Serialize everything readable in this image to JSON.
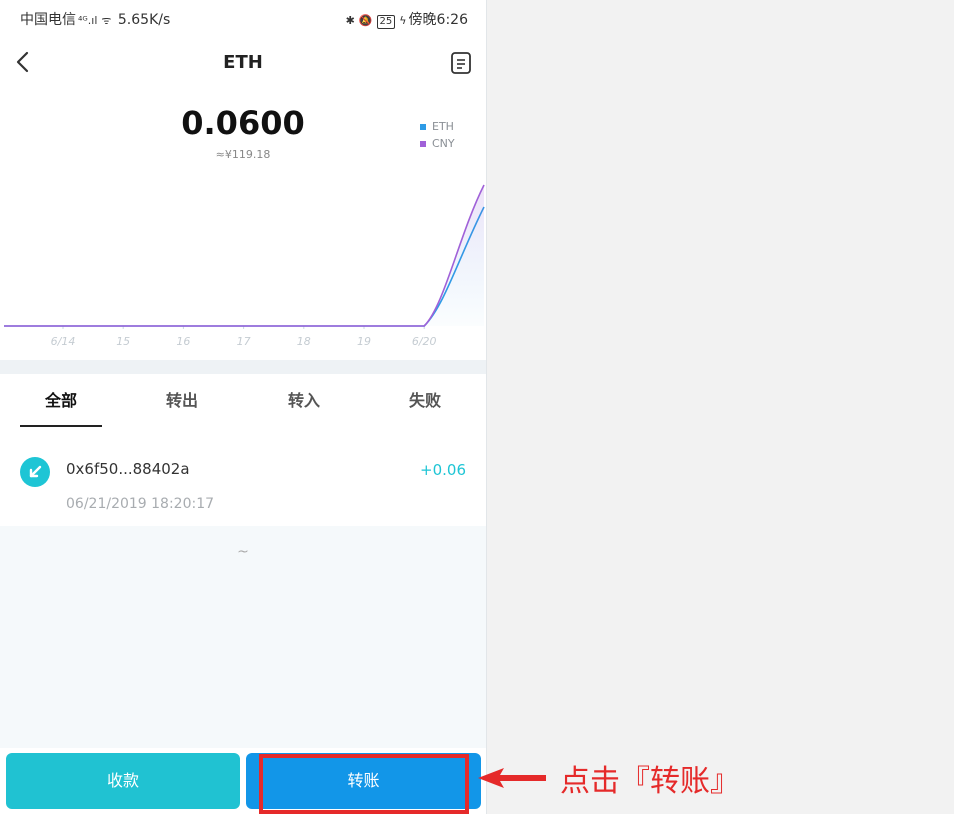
{
  "status_bar": {
    "carrier": "中国电信",
    "signal": "⁴ᴳ.ıl",
    "speed": "5.65K/s",
    "battery": "25",
    "time": "傍晚6:26"
  },
  "header": {
    "title": "ETH"
  },
  "balance": {
    "amount": "0.0600",
    "cny_value": "≈¥119.18"
  },
  "chart_data": {
    "type": "line",
    "x": [
      "6/14",
      "15",
      "16",
      "17",
      "18",
      "19",
      "6/20"
    ],
    "series": [
      {
        "name": "ETH",
        "color": "#2e9be6",
        "values": [
          0,
          0,
          0,
          0,
          0,
          0,
          0,
          0.06
        ]
      },
      {
        "name": "CNY",
        "color": "#a061d8",
        "values": [
          0,
          0,
          0,
          0,
          0,
          0,
          0,
          119.18
        ]
      }
    ],
    "legend": "top-right",
    "grid": false
  },
  "tabs": [
    {
      "label": "全部",
      "active": true
    },
    {
      "label": "转出",
      "active": false
    },
    {
      "label": "转入",
      "active": false
    },
    {
      "label": "失败",
      "active": false
    }
  ],
  "transactions": [
    {
      "hash": "0x6f50...88402a",
      "amount": "+0.06",
      "time": "06/21/2019 18:20:17"
    }
  ],
  "list_end_marker": "~",
  "actions": {
    "receive_label": "收款",
    "transfer_label": "转账"
  },
  "annotation": {
    "text": "点击『转账』",
    "color": "#e52a2a"
  },
  "colors": {
    "accent_teal": "#20c2d2",
    "accent_blue": "#1296e8"
  }
}
